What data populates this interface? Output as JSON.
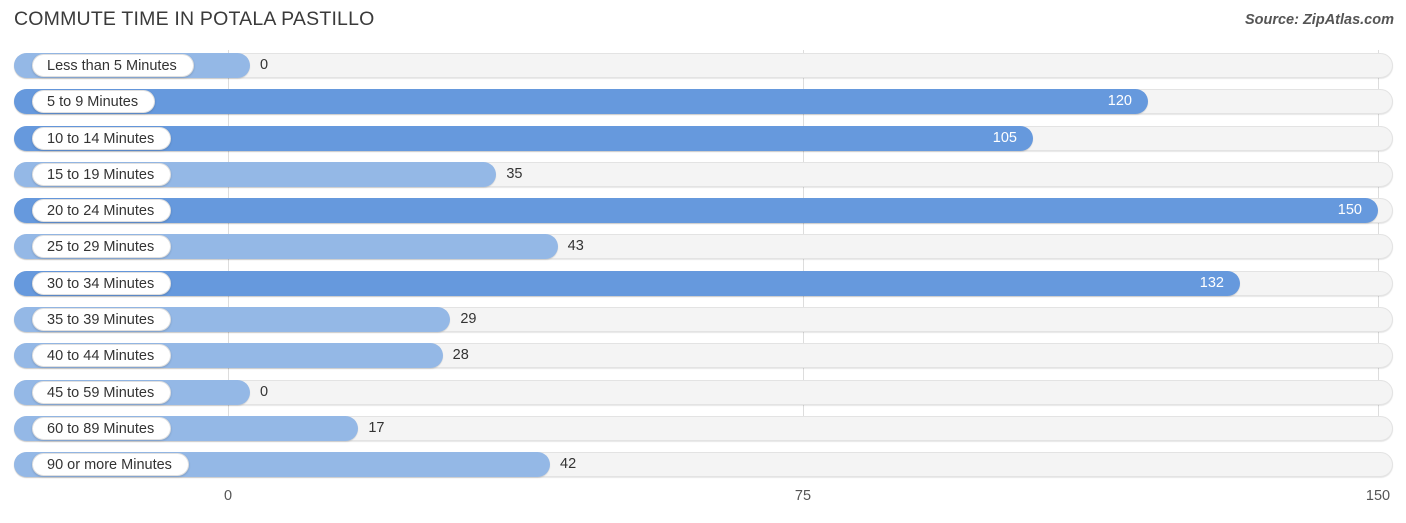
{
  "header": {
    "title": "COMMUTE TIME IN POTALA PASTILLO",
    "source": "Source: ZipAtlas.com"
  },
  "colors": {
    "bar_light": "#94b8e6",
    "bar_dark": "#6699dd",
    "track": "#f4f4f4",
    "gridline": "#dddddd",
    "text": "#333333",
    "value_inside": "#ffffff"
  },
  "axis": {
    "ticks": [
      "0",
      "75",
      "150"
    ],
    "min": 0,
    "max": 150
  },
  "chart_data": {
    "type": "bar",
    "orientation": "horizontal",
    "title": "COMMUTE TIME IN POTALA PASTILLO",
    "xlabel": "",
    "ylabel": "",
    "xlim": [
      0,
      150
    ],
    "grid": true,
    "legend": "none",
    "source": "Source: ZipAtlas.com",
    "categories": [
      "Less than 5 Minutes",
      "5 to 9 Minutes",
      "10 to 14 Minutes",
      "15 to 19 Minutes",
      "20 to 24 Minutes",
      "25 to 29 Minutes",
      "30 to 34 Minutes",
      "35 to 39 Minutes",
      "40 to 44 Minutes",
      "45 to 59 Minutes",
      "60 to 89 Minutes",
      "90 or more Minutes"
    ],
    "values": [
      0,
      120,
      105,
      35,
      150,
      43,
      132,
      29,
      28,
      0,
      17,
      42
    ],
    "value_labels": [
      "0",
      "120",
      "105",
      "35",
      "150",
      "43",
      "132",
      "29",
      "28",
      "0",
      "17",
      "42"
    ]
  },
  "rows": [
    {
      "label": "Less than 5 Minutes",
      "value": 0,
      "display": "0",
      "tone": "light",
      "inside": false
    },
    {
      "label": "5 to 9 Minutes",
      "value": 120,
      "display": "120",
      "tone": "dark",
      "inside": true
    },
    {
      "label": "10 to 14 Minutes",
      "value": 105,
      "display": "105",
      "tone": "dark",
      "inside": true
    },
    {
      "label": "15 to 19 Minutes",
      "value": 35,
      "display": "35",
      "tone": "light",
      "inside": false
    },
    {
      "label": "20 to 24 Minutes",
      "value": 150,
      "display": "150",
      "tone": "dark",
      "inside": true
    },
    {
      "label": "25 to 29 Minutes",
      "value": 43,
      "display": "43",
      "tone": "light",
      "inside": false
    },
    {
      "label": "30 to 34 Minutes",
      "value": 132,
      "display": "132",
      "tone": "dark",
      "inside": true
    },
    {
      "label": "35 to 39 Minutes",
      "value": 29,
      "display": "29",
      "tone": "light",
      "inside": false
    },
    {
      "label": "40 to 44 Minutes",
      "value": 28,
      "display": "28",
      "tone": "light",
      "inside": false
    },
    {
      "label": "45 to 59 Minutes",
      "value": 0,
      "display": "0",
      "tone": "light",
      "inside": false
    },
    {
      "label": "60 to 89 Minutes",
      "value": 17,
      "display": "17",
      "tone": "light",
      "inside": false
    },
    {
      "label": "90 or more Minutes",
      "value": 42,
      "display": "42",
      "tone": "light",
      "inside": false
    }
  ]
}
